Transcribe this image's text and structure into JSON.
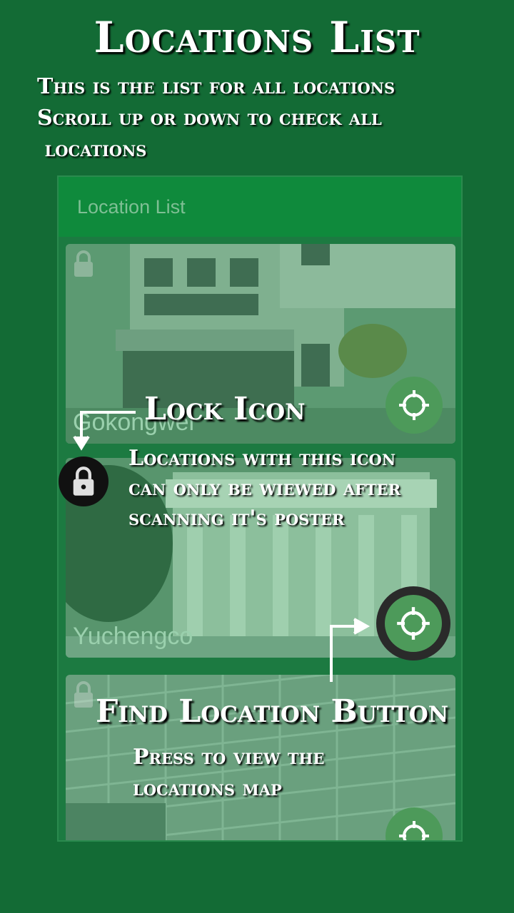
{
  "tutorial": {
    "title": "Locations List",
    "subtitle_lines": [
      "This is the list for all locations",
      "Scroll up or down to check all",
      " locations"
    ],
    "lock_title": "Lock Icon",
    "lock_desc_lines": [
      "Locations with this icon",
      "can only be wiewed after",
      "scanning it's poster"
    ],
    "find_title": "Find Location Button",
    "find_desc_lines": [
      "Press to view the",
      "locations map"
    ]
  },
  "app": {
    "toolbar_title": "Location List",
    "locations": [
      {
        "name": "Gokongwei",
        "locked": true,
        "find_icon": "crosshair-icon"
      },
      {
        "name": "Yuchengco",
        "locked": true,
        "find_icon": "crosshair-icon"
      },
      {
        "name": "",
        "locked": true,
        "find_icon": "crosshair-icon"
      }
    ]
  },
  "colors": {
    "background": "#136b35",
    "appbar": "#0f8a3c",
    "card_tint": "#3f8d5e",
    "find_button": "#4d9a5a"
  }
}
